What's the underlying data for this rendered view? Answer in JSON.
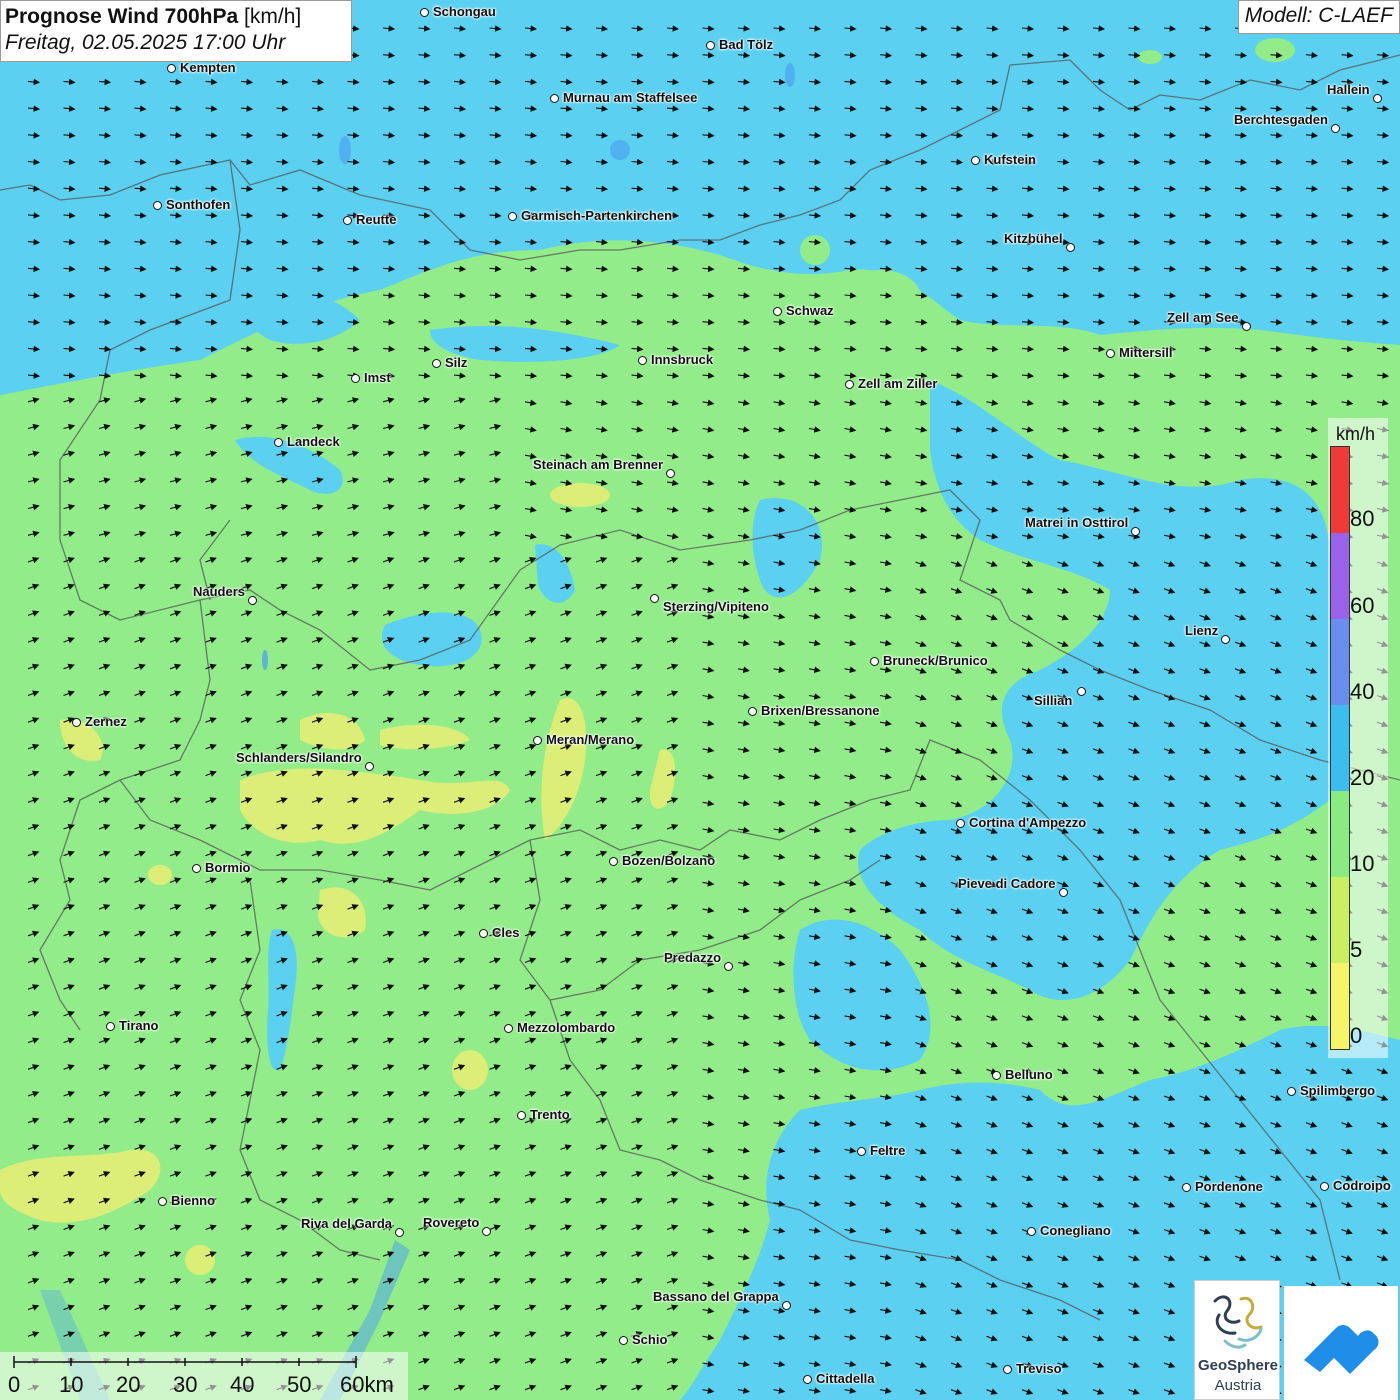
{
  "title": {
    "main": "Prognose Wind 700hPa",
    "unit": "[km/h]",
    "datetime": "Freitag, 02.05.2025 17:00 Uhr"
  },
  "model": "Modell: C-LAEF",
  "legend": {
    "unit": "km/h",
    "ticks": [
      "80",
      "60",
      "40",
      "20",
      "10",
      "5",
      "0"
    ],
    "colors": [
      "#f03a3a",
      "#9a62ea",
      "#6a8ef0",
      "#3cbdf0",
      "#88ec80",
      "#c8f060",
      "#f6f468"
    ]
  },
  "scale_bar": {
    "labels": [
      "0",
      "10",
      "20",
      "30",
      "40",
      "50",
      "60km"
    ]
  },
  "logo": {
    "name_line1": "GeoSphere",
    "name_line2": "Austria"
  },
  "map_colors": {
    "blue_20_40": "#5bd0f0",
    "blue_40_60": "#4a9df0",
    "green_10_20": "#92ec8a",
    "yellow_5_10": "#dcee78"
  },
  "cities": [
    {
      "name": "Schongau"
    },
    {
      "name": "Bad Tölz"
    },
    {
      "name": "Kempten"
    },
    {
      "name": "Murnau am Staffelsee"
    },
    {
      "name": "Hallein"
    },
    {
      "name": "Berchtesgaden"
    },
    {
      "name": "Kufstein"
    },
    {
      "name": "Sonthofen"
    },
    {
      "name": "Reutte"
    },
    {
      "name": "Garmisch-Partenkirchen"
    },
    {
      "name": "Kitzbühel"
    },
    {
      "name": "Schwaz"
    },
    {
      "name": "Zell am See"
    },
    {
      "name": "Mittersill"
    },
    {
      "name": "Innsbruck"
    },
    {
      "name": "Imst"
    },
    {
      "name": "Silz"
    },
    {
      "name": "Zell am Ziller"
    },
    {
      "name": "Landeck"
    },
    {
      "name": "Steinach am Brenner"
    },
    {
      "name": "Matrei in Osttirol"
    },
    {
      "name": "Nauders"
    },
    {
      "name": "Sterzing/Vipiteno"
    },
    {
      "name": "Lienz"
    },
    {
      "name": "Bruneck/Brunico"
    },
    {
      "name": "Sillian"
    },
    {
      "name": "Brixen/Bressanone"
    },
    {
      "name": "Zernez"
    },
    {
      "name": "Meran/Merano"
    },
    {
      "name": "Schlanders/Silandro"
    },
    {
      "name": "Cortina d'Ampezzo"
    },
    {
      "name": "Bozen/Bolzano"
    },
    {
      "name": "Bormio"
    },
    {
      "name": "Pieve di Cadore"
    },
    {
      "name": "Cles"
    },
    {
      "name": "Predazzo"
    },
    {
      "name": "Tirano"
    },
    {
      "name": "Mezzolombardo"
    },
    {
      "name": "Belluno"
    },
    {
      "name": "Spilimbergo"
    },
    {
      "name": "Trento"
    },
    {
      "name": "Feltre"
    },
    {
      "name": "Pordenone"
    },
    {
      "name": "Codroipo"
    },
    {
      "name": "Bienno"
    },
    {
      "name": "Riva del Garda"
    },
    {
      "name": "Rovereto"
    },
    {
      "name": "Conegliano"
    },
    {
      "name": "Bassano del Grappa"
    },
    {
      "name": "Schio"
    },
    {
      "name": "Treviso"
    },
    {
      "name": "Cittadella"
    }
  ]
}
